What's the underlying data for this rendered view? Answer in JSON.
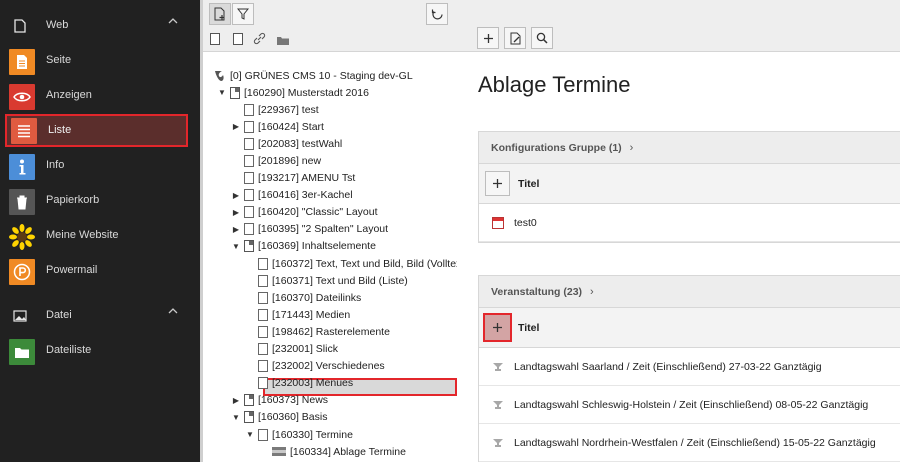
{
  "sidebar": {
    "groups": [
      {
        "title": "Web",
        "icon": "page-icon",
        "chevron": "^"
      },
      {
        "title": "Datei",
        "icon": "image-icon",
        "chevron": "^"
      }
    ],
    "web_modules": [
      {
        "label": "Seite",
        "icon": "page-module-icon",
        "color": "#f08a24"
      },
      {
        "label": "Anzeigen",
        "icon": "eye-icon",
        "color": "#d93a30"
      },
      {
        "label": "Liste",
        "icon": "list-icon",
        "color": "#e05b40"
      },
      {
        "label": "Info",
        "icon": "info-icon",
        "color": "#4c8ed8"
      },
      {
        "label": "Papierkorb",
        "icon": "trash-icon",
        "color": "#555555"
      },
      {
        "label": "Meine Website",
        "icon": "sunflower-icon",
        "color": "#ffd400"
      },
      {
        "label": "Powermail",
        "icon": "powermail-icon",
        "color": "#f08a24"
      }
    ],
    "file_modules": [
      {
        "label": "Dateiliste",
        "icon": "filelist-icon",
        "color": "#3c8a3a"
      }
    ],
    "active_color": "#e3262b"
  },
  "tree": {
    "root": "[0] GRÜNES CMS 10 - Staging dev-GL",
    "rows": [
      {
        "text": "[160290] Musterstadt 2016",
        "toggle": "▼"
      },
      {
        "text": "[229367] test",
        "toggle": ""
      },
      {
        "text": "[160424] Start",
        "toggle": "▶"
      },
      {
        "text": "[202083] testWahl",
        "toggle": ""
      },
      {
        "text": "[201896] new",
        "toggle": ""
      },
      {
        "text": "[193217] AMENU Tst",
        "toggle": ""
      },
      {
        "text": "[160416] 3er-Kachel",
        "toggle": "▶"
      },
      {
        "text": "[160420] \"Classic\" Layout",
        "toggle": "▶"
      },
      {
        "text": "[160395] \"2 Spalten\" Layout",
        "toggle": "▶"
      },
      {
        "text": "[160369] Inhaltselemente",
        "toggle": "▼"
      },
      {
        "text": "[160372] Text, Text und Bild, Bild (Volltex",
        "toggle": ""
      },
      {
        "text": "[160371] Text und Bild (Liste)",
        "toggle": ""
      },
      {
        "text": "[160370] Dateilinks",
        "toggle": ""
      },
      {
        "text": "[171443] Medien",
        "toggle": ""
      },
      {
        "text": "[198462] Rasterelemente",
        "toggle": ""
      },
      {
        "text": "[232001] Slick",
        "toggle": ""
      },
      {
        "text": "[232002] Verschiedenes",
        "toggle": ""
      },
      {
        "text": "[232003] Menues",
        "toggle": ""
      },
      {
        "text": "[160373] News",
        "toggle": "▶"
      },
      {
        "text": "[160360] Basis",
        "toggle": "▼"
      },
      {
        "text": "[160330] Termine",
        "toggle": "▼"
      },
      {
        "text": "[160334] Ablage Termine",
        "toggle": ""
      }
    ]
  },
  "content": {
    "title": "Ablage Termine",
    "panels": [
      {
        "header": "Konfigurations Gruppe (1)",
        "column": "Titel",
        "rows": [
          "test0"
        ]
      },
      {
        "header": "Veranstaltung (23)",
        "column": "Titel",
        "rows": [
          "Landtagswahl Saarland / Zeit (Einschließend) 27-03-22 Ganztägig",
          "Landtagswahl Schleswig-Holstein / Zeit (Einschließend) 08-05-22 Ganztägig",
          "Landtagswahl Nordrhein-Westfalen / Zeit (Einschließend) 15-05-22 Ganztägig"
        ]
      }
    ]
  },
  "toolbar": {
    "new_page_icon": "+",
    "filter_icon": "▽",
    "refresh_icon": "↻",
    "add_icon": "+",
    "edit_icon": "✎",
    "search_icon": "⌕"
  }
}
